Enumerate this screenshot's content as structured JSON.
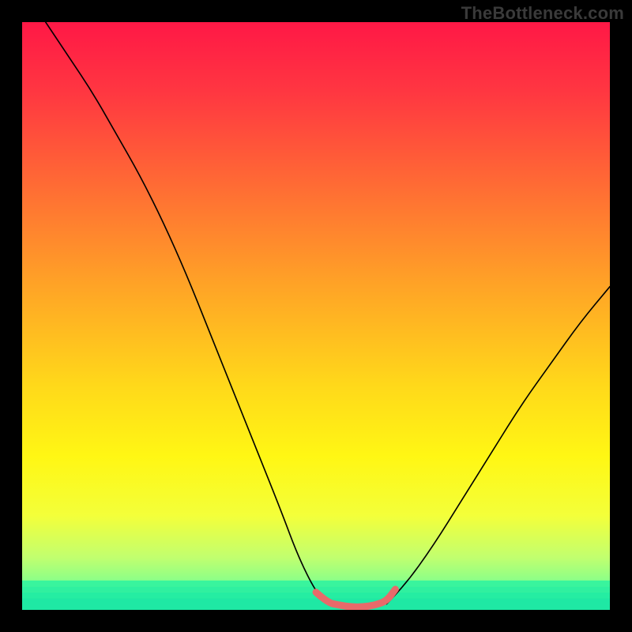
{
  "watermark": "TheBottleneck.com",
  "colors": {
    "black": "#000000",
    "watermark_text": "#3a3a3a",
    "curve": "#000000",
    "highlight": "#e86a6a",
    "gradient_stops": [
      {
        "offset": 0.0,
        "color": "#ff1846"
      },
      {
        "offset": 0.12,
        "color": "#ff3741"
      },
      {
        "offset": 0.28,
        "color": "#ff6c34"
      },
      {
        "offset": 0.45,
        "color": "#ffa426"
      },
      {
        "offset": 0.62,
        "color": "#ffd91a"
      },
      {
        "offset": 0.74,
        "color": "#fff714"
      },
      {
        "offset": 0.84,
        "color": "#f3ff3a"
      },
      {
        "offset": 0.91,
        "color": "#c2ff6e"
      },
      {
        "offset": 0.96,
        "color": "#7fff8e"
      },
      {
        "offset": 1.0,
        "color": "#26f59a"
      }
    ],
    "bottom_bands": [
      {
        "y": 0.95,
        "h": 0.01,
        "color": "#39f49d"
      },
      {
        "y": 0.96,
        "h": 0.01,
        "color": "#2ff0a0"
      },
      {
        "y": 0.97,
        "h": 0.01,
        "color": "#25eda2"
      },
      {
        "y": 0.98,
        "h": 0.02,
        "color": "#1fe8a4"
      }
    ]
  },
  "chart_data": {
    "type": "line",
    "title": "",
    "xlabel": "",
    "ylabel": "",
    "xlim": [
      0,
      1
    ],
    "ylim": [
      0,
      1
    ],
    "grid": false,
    "legend": false,
    "series": [
      {
        "name": "left-curve",
        "x": [
          0.04,
          0.08,
          0.12,
          0.16,
          0.2,
          0.24,
          0.28,
          0.32,
          0.36,
          0.4,
          0.44,
          0.47,
          0.5,
          0.52
        ],
        "y": [
          1.0,
          0.94,
          0.88,
          0.81,
          0.74,
          0.66,
          0.57,
          0.47,
          0.37,
          0.27,
          0.17,
          0.09,
          0.03,
          0.01
        ]
      },
      {
        "name": "right-curve",
        "x": [
          0.62,
          0.65,
          0.7,
          0.75,
          0.8,
          0.85,
          0.9,
          0.95,
          1.0
        ],
        "y": [
          0.01,
          0.04,
          0.11,
          0.19,
          0.27,
          0.35,
          0.42,
          0.49,
          0.55
        ]
      },
      {
        "name": "bottom-highlight",
        "x": [
          0.5,
          0.52,
          0.54,
          0.56,
          0.58,
          0.6,
          0.62,
          0.635
        ],
        "y": [
          0.03,
          0.012,
          0.008,
          0.005,
          0.005,
          0.008,
          0.015,
          0.035
        ]
      }
    ],
    "annotations": []
  }
}
